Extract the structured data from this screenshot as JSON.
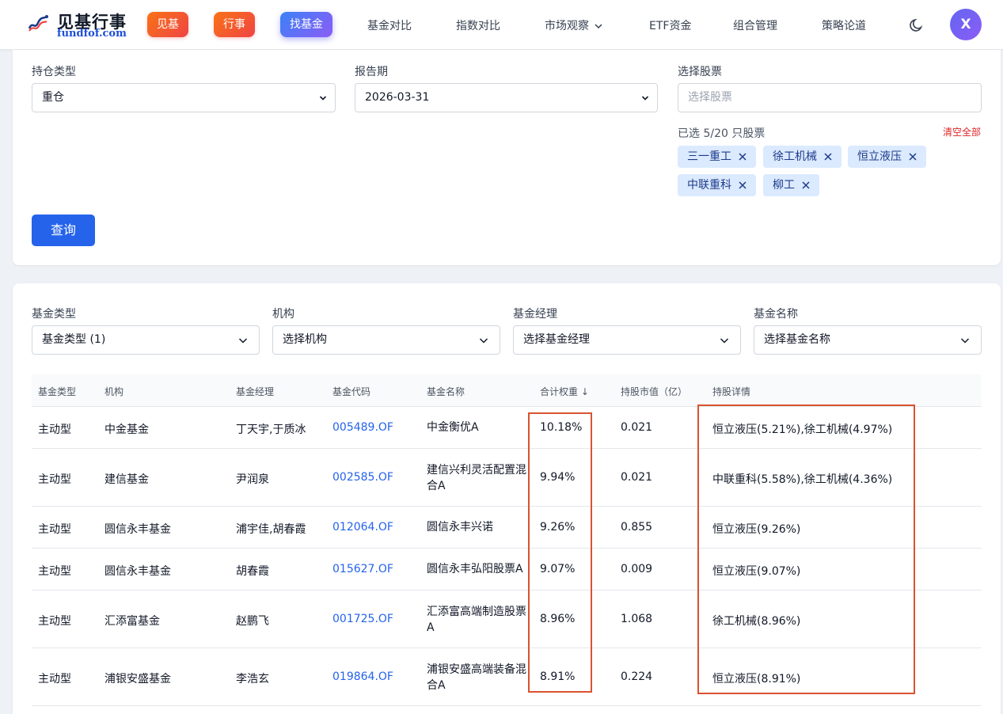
{
  "header": {
    "logo_title": "见基行事",
    "logo_sub": "fundfof.com",
    "nav_pills": [
      "见基",
      "行事",
      "找基金"
    ],
    "nav_links": [
      "基金对比",
      "指数对比",
      "市场观察",
      "ETF资金",
      "组合管理",
      "策略论道"
    ],
    "avatar_initial": "X"
  },
  "filters": {
    "holding_type_label": "持仓类型",
    "holding_type_value": "重仓",
    "report_period_label": "报告期",
    "report_period_value": "2026-03-31",
    "stock_select_label": "选择股票",
    "stock_select_placeholder": "选择股票",
    "selected_count": "已选 5/20 只股票",
    "clear_all": "清空全部",
    "selected_stocks": [
      "三一重工",
      "徐工机械",
      "恒立液压",
      "中联重科",
      "柳工"
    ],
    "query_button": "查询"
  },
  "result_filters": {
    "fund_type_label": "基金类型",
    "fund_type_value": "基金类型 (1)",
    "institution_label": "机构",
    "institution_value": "选择机构",
    "manager_label": "基金经理",
    "manager_value": "选择基金经理",
    "fund_name_label": "基金名称",
    "fund_name_value": "选择基金名称"
  },
  "table": {
    "columns": [
      "基金类型",
      "机构",
      "基金经理",
      "基金代码",
      "基金名称",
      "合计权重 ↓",
      "持股市值（亿）",
      "持股详情"
    ],
    "rows": [
      {
        "type": "主动型",
        "institution": "中金基金",
        "manager": "丁天宇,于质冰",
        "code": "005489.OF",
        "name": "中金衡优A",
        "weight": "10.18%",
        "value": "0.021",
        "detail": "恒立液压(5.21%),徐工机械(4.97%)"
      },
      {
        "type": "主动型",
        "institution": "建信基金",
        "manager": "尹润泉",
        "code": "002585.OF",
        "name": "建信兴利灵活配置混合A",
        "weight": "9.94%",
        "value": "0.021",
        "detail": "中联重科(5.58%),徐工机械(4.36%)"
      },
      {
        "type": "主动型",
        "institution": "圆信永丰基金",
        "manager": "浦宇佳,胡春霞",
        "code": "012064.OF",
        "name": "圆信永丰兴诺",
        "weight": "9.26%",
        "value": "0.855",
        "detail": "恒立液压(9.26%)"
      },
      {
        "type": "主动型",
        "institution": "圆信永丰基金",
        "manager": "胡春霞",
        "code": "015627.OF",
        "name": "圆信永丰弘阳股票A",
        "weight": "9.07%",
        "value": "0.009",
        "detail": "恒立液压(9.07%)"
      },
      {
        "type": "主动型",
        "institution": "汇添富基金",
        "manager": "赵鹏飞",
        "code": "001725.OF",
        "name": "汇添富高端制造股票A",
        "weight": "8.96%",
        "value": "1.068",
        "detail": "徐工机械(8.96%)"
      },
      {
        "type": "主动型",
        "institution": "浦银安盛基金",
        "manager": "李浩玄",
        "code": "019864.OF",
        "name": "浦银安盛高端装备混合A",
        "weight": "8.91%",
        "value": "0.224",
        "detail": "恒立液压(8.91%)"
      }
    ]
  },
  "colors": {
    "primary": "#2563eb",
    "highlight_box": "#d9532f",
    "tag_bg": "#dbeafe",
    "danger": "#dc2626"
  }
}
